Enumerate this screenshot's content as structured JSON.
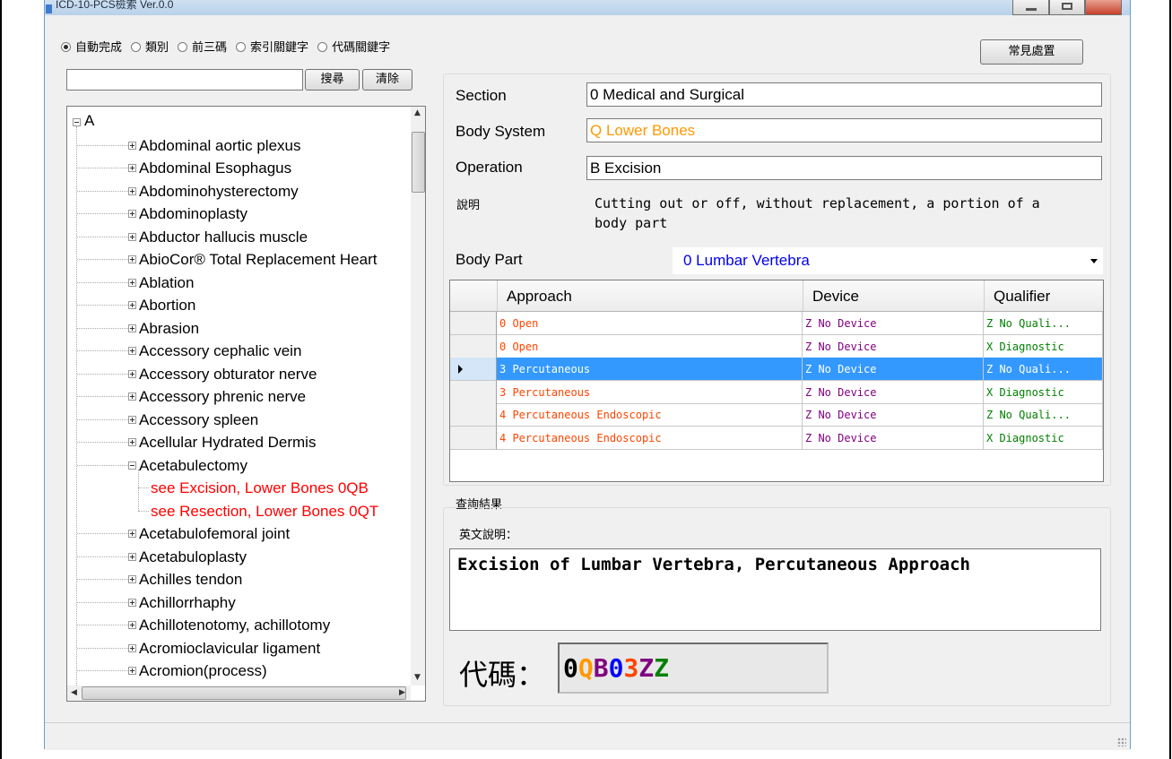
{
  "window": {
    "title": "ICD-10-PCS檢索 Ver.0.0"
  },
  "search_modes": [
    {
      "label": "自動完成",
      "selected": true
    },
    {
      "label": "類別",
      "selected": false
    },
    {
      "label": "前三碼",
      "selected": false
    },
    {
      "label": "索引關鍵字",
      "selected": false
    },
    {
      "label": "代碼關鍵字",
      "selected": false
    }
  ],
  "toolbar": {
    "common_button": "常見處置",
    "search_button": "搜尋",
    "clear_button": "清除",
    "search_value": ""
  },
  "tree": {
    "root": "A",
    "items": [
      {
        "label": "Abdominal aortic plexus",
        "type": "plus"
      },
      {
        "label": "Abdominal Esophagus",
        "type": "plus"
      },
      {
        "label": "Abdominohysterectomy",
        "type": "plus"
      },
      {
        "label": "Abdominoplasty",
        "type": "plus"
      },
      {
        "label": "Abductor hallucis muscle",
        "type": "plus"
      },
      {
        "label": "AbioCor® Total Replacement Heart",
        "type": "plus"
      },
      {
        "label": "Ablation",
        "type": "plus"
      },
      {
        "label": "Abortion",
        "type": "plus"
      },
      {
        "label": "Abrasion",
        "type": "plus"
      },
      {
        "label": "Accessory cephalic vein",
        "type": "plus"
      },
      {
        "label": "Accessory obturator nerve",
        "type": "plus"
      },
      {
        "label": "Accessory phrenic nerve",
        "type": "plus"
      },
      {
        "label": "Accessory spleen",
        "type": "plus"
      },
      {
        "label": "Acellular Hydrated Dermis",
        "type": "plus"
      },
      {
        "label": "Acetabulectomy",
        "type": "minus"
      },
      {
        "label": "see Excision, Lower Bones 0QB",
        "type": "child"
      },
      {
        "label": "see Resection, Lower Bones 0QT",
        "type": "child"
      },
      {
        "label": "Acetabulofemoral joint",
        "type": "plus"
      },
      {
        "label": "Acetabuloplasty",
        "type": "plus"
      },
      {
        "label": "Achilles tendon",
        "type": "plus"
      },
      {
        "label": "Achillorrhaphy",
        "type": "plus"
      },
      {
        "label": "Achillotenotomy, achillotomy",
        "type": "plus"
      },
      {
        "label": "Acromioclavicular ligament",
        "type": "plus"
      },
      {
        "label": "Acromion(process)",
        "type": "plus"
      }
    ]
  },
  "details": {
    "section_label": "Section",
    "section_value": "0 Medical and Surgical",
    "body_system_label": "Body System",
    "body_system_value": "Q Lower Bones",
    "operation_label": "Operation",
    "operation_value": "B Excision",
    "desc_label": "說明",
    "desc_text": "Cutting out or off, without replacement, a portion of a body part",
    "body_part_label": "Body Part",
    "body_part_value": "0 Lumbar Vertebra"
  },
  "grid": {
    "columns": [
      "Approach",
      "Device",
      "Qualifier"
    ],
    "rows": [
      {
        "approach": "0 Open",
        "device": "Z No Device",
        "qualifier": "Z No Quali...",
        "selected": false
      },
      {
        "approach": "0 Open",
        "device": "Z No Device",
        "qualifier": "X Diagnostic",
        "selected": false
      },
      {
        "approach": "3 Percutaneous",
        "device": "Z No Device",
        "qualifier": "Z No Quali...",
        "selected": true
      },
      {
        "approach": "3 Percutaneous",
        "device": "Z No Device",
        "qualifier": "X Diagnostic",
        "selected": false
      },
      {
        "approach": "4 Percutaneous Endoscopic",
        "device": "Z No Device",
        "qualifier": "Z No Quali...",
        "selected": false
      },
      {
        "approach": "4 Percutaneous Endoscopic",
        "device": "Z No Device",
        "qualifier": "X Diagnostic",
        "selected": false
      }
    ]
  },
  "result": {
    "group_label": "查詢結果",
    "english_label": "英文說明：",
    "english_text": "Excision of Lumbar Vertebra, Percutaneous Approach",
    "code_label": "代碼：",
    "code_chars": [
      {
        "ch": "0",
        "color": "#000000"
      },
      {
        "ch": "Q",
        "color": "#ff9900"
      },
      {
        "ch": "B",
        "color": "#800080"
      },
      {
        "ch": "0",
        "color": "#0000ff"
      },
      {
        "ch": "3",
        "color": "#ff4500"
      },
      {
        "ch": "Z",
        "color": "#800080"
      },
      {
        "ch": "Z",
        "color": "#008000"
      }
    ]
  },
  "colors": {
    "body_system": "#ff9900",
    "body_part": "#0000ee",
    "approach": "#ff4500",
    "device": "#800080",
    "qualifier": "#008000",
    "tree_red": "#ff0000",
    "grid_selected": "#3399ff"
  }
}
